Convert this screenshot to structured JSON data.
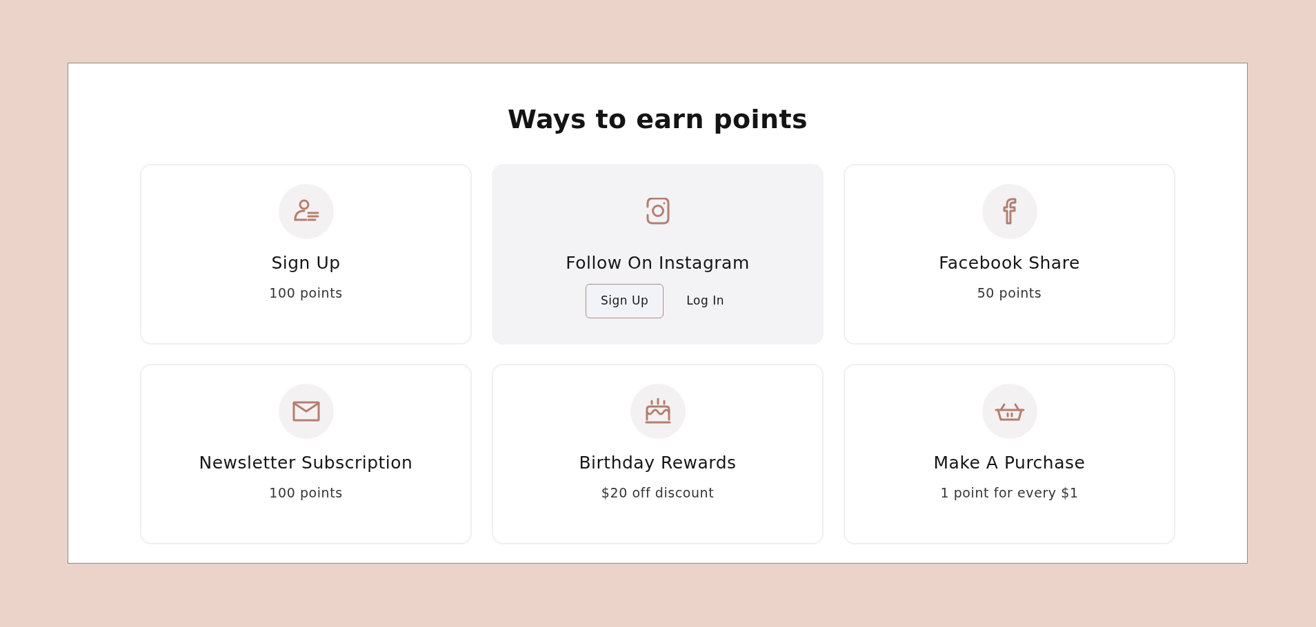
{
  "title": "Ways to earn points",
  "cards": [
    {
      "kind": "points",
      "title": "Sign Up",
      "detail": "100 points",
      "highlighted": false
    },
    {
      "kind": "actions",
      "title": "Follow On Instagram",
      "highlighted": true,
      "buttons": [
        {
          "kind": "outlined",
          "label": "Sign Up"
        },
        {
          "kind": "plain",
          "label": "Log In"
        }
      ]
    },
    {
      "kind": "points",
      "title": "Facebook Share",
      "detail": "50 points",
      "highlighted": false
    },
    {
      "kind": "points",
      "title": "Newsletter Subscription",
      "detail": "100 points",
      "highlighted": false
    },
    {
      "kind": "points",
      "title": "Birthday Rewards",
      "detail": "$20 off discount",
      "highlighted": false
    },
    {
      "kind": "points",
      "title": "Make A Purchase",
      "detail": "1 point for every $1",
      "highlighted": false
    }
  ]
}
